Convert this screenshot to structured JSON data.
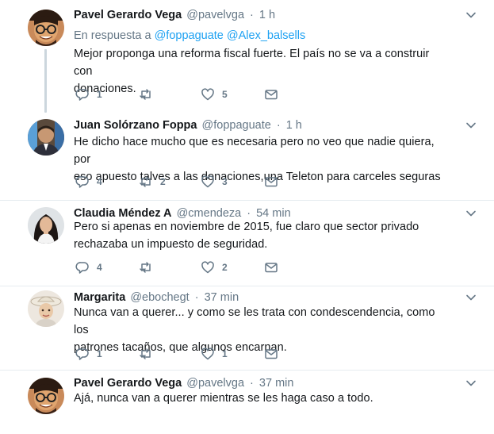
{
  "tweets": [
    {
      "fullname": "Pavel Gerardo Vega",
      "username": "@pavelvga",
      "dot": "·",
      "time": "1 h",
      "replying_prefix": "En respuesta a",
      "mentions": [
        "@foppaguate",
        "@Alex_balsells"
      ],
      "lines": [
        "Mejor proponga una reforma fiscal fuerte. El país no se va a construir con",
        "donaciones."
      ],
      "reply_count": "1",
      "retweet_count": "",
      "like_count": "5",
      "avatar_icon": "avatar-glasses-man"
    },
    {
      "fullname": "Juan Solórzano Foppa",
      "username": "@foppaguate",
      "dot": "·",
      "time": "1 h",
      "lines": [
        "He dicho hace mucho que es necesaria pero no veo que nadie quiera, por",
        "eso apuesto talves a las donaciones,una Teleton para carceles seguras"
      ],
      "reply_count": "4",
      "retweet_count": "2",
      "like_count": "3",
      "avatar_icon": "avatar-man-flag"
    },
    {
      "fullname": "Claudia Méndez A",
      "username": "@cmendeza",
      "dot": "·",
      "time": "54 min",
      "lines": [
        "Pero si apenas en noviembre de 2015, fue claro que sector privado",
        "rechazaba un impuesto de seguridad."
      ],
      "reply_count": "4",
      "retweet_count": "",
      "like_count": "2",
      "avatar_icon": "avatar-woman-dark-hair"
    },
    {
      "fullname": "Margarita",
      "username": "@ebochegt",
      "dot": "·",
      "time": "37 min",
      "lines": [
        "Nunca van a querer... y como se les trata con condescendencia, como los",
        "patrones tacaños,  que algunos encarnan."
      ],
      "reply_count": "1",
      "retweet_count": "",
      "like_count": "1",
      "avatar_icon": "avatar-woman-hat"
    },
    {
      "fullname": "Pavel Gerardo Vega",
      "username": "@pavelvga",
      "dot": "·",
      "time": "37 min",
      "lines": [
        "Ajá, nunca van a querer mientras se les haga caso a todo."
      ],
      "avatar_icon": "avatar-glasses-man"
    }
  ],
  "colors": {
    "accent": "#1da1f2",
    "secondary_text": "#657786",
    "thread_line": "#ccd6dd",
    "border": "#e6ecf0"
  }
}
